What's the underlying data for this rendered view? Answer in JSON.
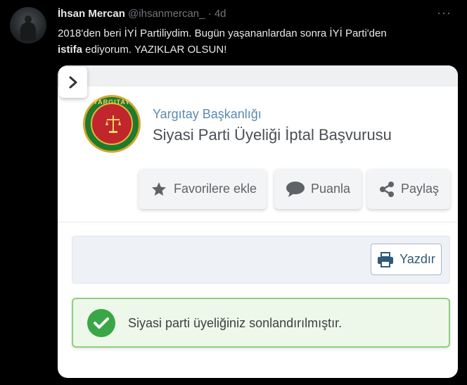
{
  "author": {
    "name": "İhsan Mercan",
    "handle": "@ihsanmercan_",
    "separator": "·",
    "time": "4d"
  },
  "tweet": {
    "line1": "2018'den beri İYİ Partiliydim. Bugün yaşananlardan sonra İYİ Parti'den",
    "bold": "istifa",
    "rest": " ediyorum. YAZIKLAR OLSUN!"
  },
  "card": {
    "seal_text": "YARGITAY",
    "organization": "Yargıtay Başkanlığı",
    "title": "Siyasi Parti Üyeliği İptal Başvurusu",
    "buttons": {
      "favorite": "Favorilere ekle",
      "rate": "Puanla",
      "share": "Paylaş",
      "print": "Yazdır"
    },
    "alert_message": "Siyasi parti üyeliğiniz sonlandırılmıştır."
  },
  "colors": {
    "background": "#000000",
    "link_blue": "#5a8bb0",
    "success_green": "#3aa645",
    "seal_red": "#c0262b",
    "seal_green": "#1f7a2d"
  },
  "icons": [
    "more-icon",
    "chevron-right-icon",
    "star-icon",
    "comment-icon",
    "share-icon",
    "printer-icon",
    "check-circle-icon"
  ]
}
